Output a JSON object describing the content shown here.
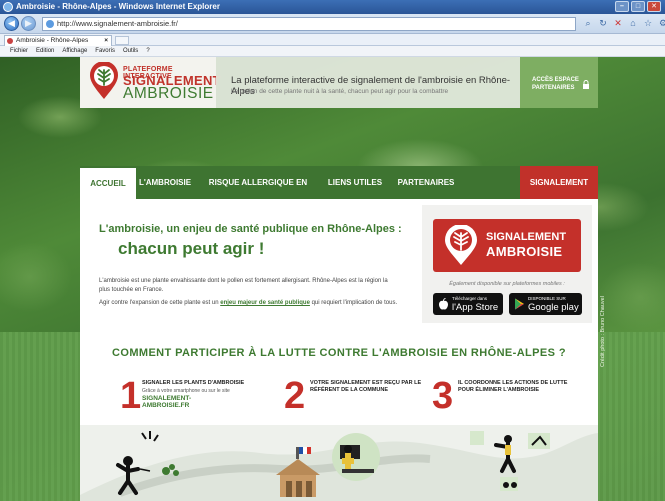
{
  "browser": {
    "window_title": "Ambroisie - Rhône-Alpes - Windows Internet Explorer",
    "url": "http://www.signalement-ambroisie.fr/",
    "tab_title": "Ambroisie - Rhône-Alpes",
    "menu": [
      "Fichier",
      "Edition",
      "Affichage",
      "Favoris",
      "Outils",
      "?"
    ]
  },
  "header": {
    "logo_small": "PLATEFORME INTERACTIVE",
    "logo_line1": "SIGNALEMENT",
    "logo_line2": "AMBROISIE",
    "tagline_title": "La plateforme interactive de signalement de l'ambroisie en Rhône-Alpes",
    "tagline_sub": "Le pollen de cette plante nuit à la santé, chacun peut agir pour la combattre",
    "partner_label": "ACCÈS ESPACE PARTENAIRES"
  },
  "nav": {
    "items": [
      "ACCUEIL",
      "L'AMBROISIE",
      "RISQUE ALLERGIQUE EN COURS",
      "LIENS UTILES",
      "PARTENAIRES"
    ],
    "signal": "SIGNALEMENT"
  },
  "intro": {
    "title": "L'ambroisie, un enjeu de santé publique en Rhône-Alpes :",
    "big": "chacun peut agir !",
    "p1": "L'ambroisie est une plante envahissante dont le pollen est fortement allergisant. Rhône-Alpes est la région la plus touchée en France.",
    "p2_before": "Agir contre l'expansion de cette plante est un ",
    "p2_highlight": "enjeu majeur de santé publique",
    "p2_after": " qui requiert l'implication de tous."
  },
  "signal_panel": {
    "line1": "SIGNALEMENT",
    "line2": "AMBROISIE",
    "also": "Également disponible sur plateformes mobiles :",
    "apple_small": "Télécharger dans",
    "apple_large": "l'App Store",
    "google_small": "DISPONIBLE SUR",
    "google_large": "Google play"
  },
  "how": {
    "title": "COMMENT PARTICIPER À LA LUTTE CONTRE L'AMBROISIE EN RHÔNE-ALPES ?",
    "steps": [
      {
        "num": "1",
        "title": "SIGNALER LES PLANTS D'AMBROISIE",
        "desc": "Grâce à votre smartphone ou sur le site",
        "link": "SIGNALEMENT-AMBROISIE.FR"
      },
      {
        "num": "2",
        "title": "VOTRE SIGNALEMENT EST REÇU PAR LE RÉFÉRENT DE LA COMMUNE",
        "desc": "",
        "link": ""
      },
      {
        "num": "3",
        "title": "IL COORDONNE LES ACTIONS DE LUTTE POUR ÉLIMINER L'AMBROISIE",
        "desc": "",
        "link": ""
      }
    ]
  },
  "credit": "Crédit photo : Bruno Chauvel"
}
